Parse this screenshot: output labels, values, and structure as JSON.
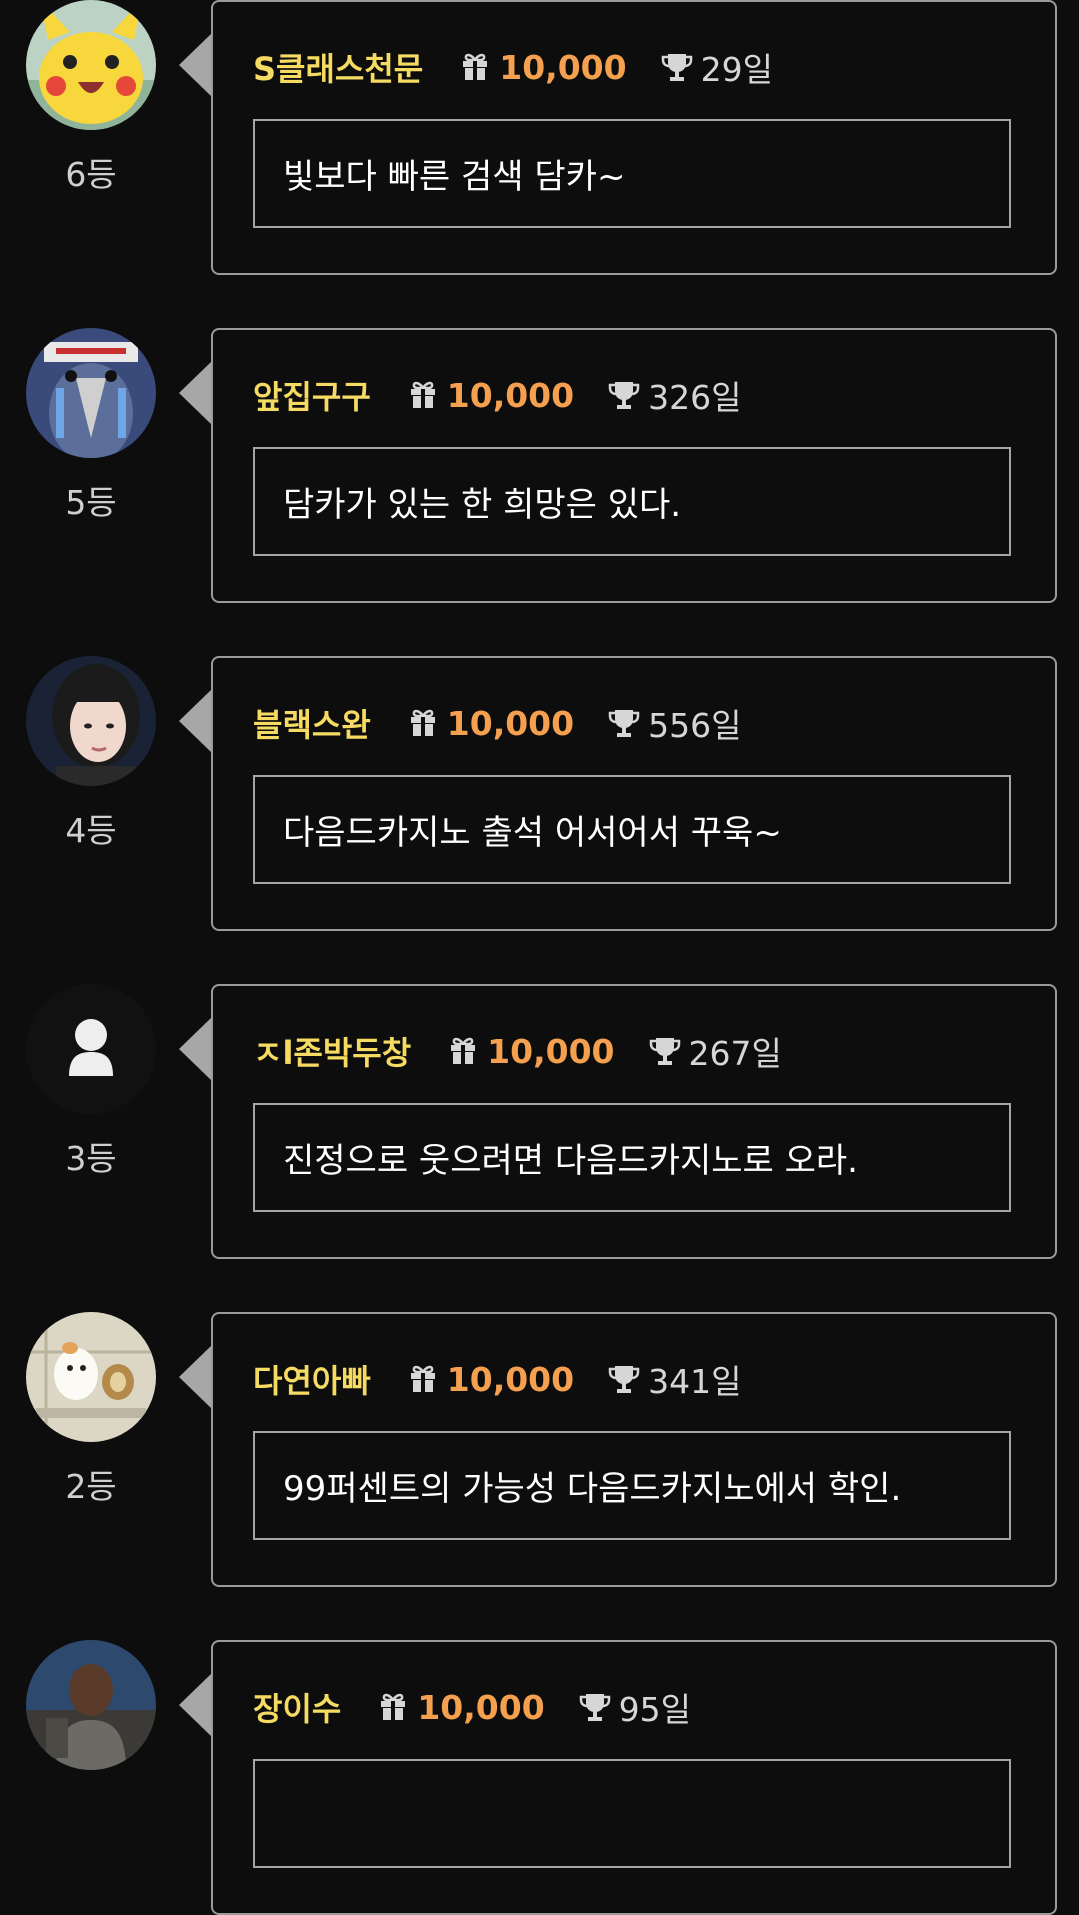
{
  "comments": [
    {
      "avatar": "pikachu-avatar",
      "rank": "6등",
      "nickname": "S클래스천문",
      "points": "10,000",
      "days": "29일",
      "message": "빛보다 빠른 검색 담카~"
    },
    {
      "avatar": "penguin-avatar",
      "rank": "5등",
      "nickname": "앞집구구",
      "points": "10,000",
      "days": "326일",
      "message": "담카가 있는 한 희망은 있다."
    },
    {
      "avatar": "woman-photo-avatar",
      "rank": "4등",
      "nickname": "블랙스완",
      "points": "10,000",
      "days": "556일",
      "message": "다음드카지노 출석 어서어서 꾸욱~"
    },
    {
      "avatar": "default-user-avatar",
      "rank": "3등",
      "nickname": "ㅈl존박두창",
      "points": "10,000",
      "days": "267일",
      "message": "진정으로 웃으려면 다음드카지노로 오라."
    },
    {
      "avatar": "hamster-avatar",
      "rank": "2등",
      "nickname": "다연아빠",
      "points": "10,000",
      "days": "341일",
      "message": "99퍼센트의 가능성 다음드카지노에서 학인."
    },
    {
      "avatar": "man-photo-avatar",
      "rank": "",
      "nickname": "장이수",
      "points": "10,000",
      "days": "95일",
      "message": ""
    }
  ],
  "colors": {
    "background": "#0d0d0d",
    "nickname": "#f6db62",
    "points": "#f4a04e",
    "border": "#9a9a9a"
  },
  "icons": {
    "points": "gift-icon",
    "days": "trophy-icon"
  }
}
